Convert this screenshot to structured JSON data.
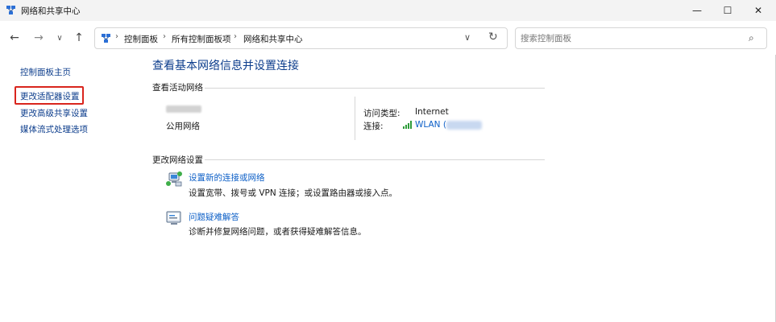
{
  "window": {
    "title": "网络和共享中心",
    "minimize": "—",
    "maximize": "☐",
    "close": "✕"
  },
  "nav": {
    "back": "←",
    "forward": "→",
    "recent": "∨",
    "up": "↑",
    "breadcrumbs": [
      "控制面板",
      "所有控制面板项",
      "网络和共享中心"
    ],
    "separator": "›",
    "dropdown": "∨",
    "refresh": "↻",
    "search_placeholder": "搜索控制面板",
    "search_icon": "⌕"
  },
  "sidebar": {
    "items": [
      {
        "label": "控制面板主页"
      },
      {
        "label": "更改适配器设置",
        "highlighted": true
      },
      {
        "label": "更改高级共享设置"
      },
      {
        "label": "媒体流式处理选项"
      }
    ]
  },
  "main": {
    "title": "查看基本网络信息并设置连接",
    "active_networks": {
      "heading": "查看活动网络",
      "network_type": "公用网络",
      "access_type_label": "访问类型:",
      "access_type_value": "Internet",
      "connection_label": "连接:",
      "connection_value": "WLAN ("
    },
    "change_settings": {
      "heading": "更改网络设置",
      "tasks": [
        {
          "icon": "network-setup-icon",
          "link": "设置新的连接或网络",
          "desc": "设置宽带、拨号或 VPN 连接；或设置路由器或接入点。"
        },
        {
          "icon": "troubleshoot-icon",
          "link": "问题疑难解答",
          "desc": "诊断并修复网络问题，或者获得疑难解答信息。"
        }
      ]
    }
  },
  "colors": {
    "link": "#0c5fc7",
    "nav_link": "#0c3d8c",
    "highlight": "#d9251d",
    "titlebar": "#f3f3f3"
  }
}
